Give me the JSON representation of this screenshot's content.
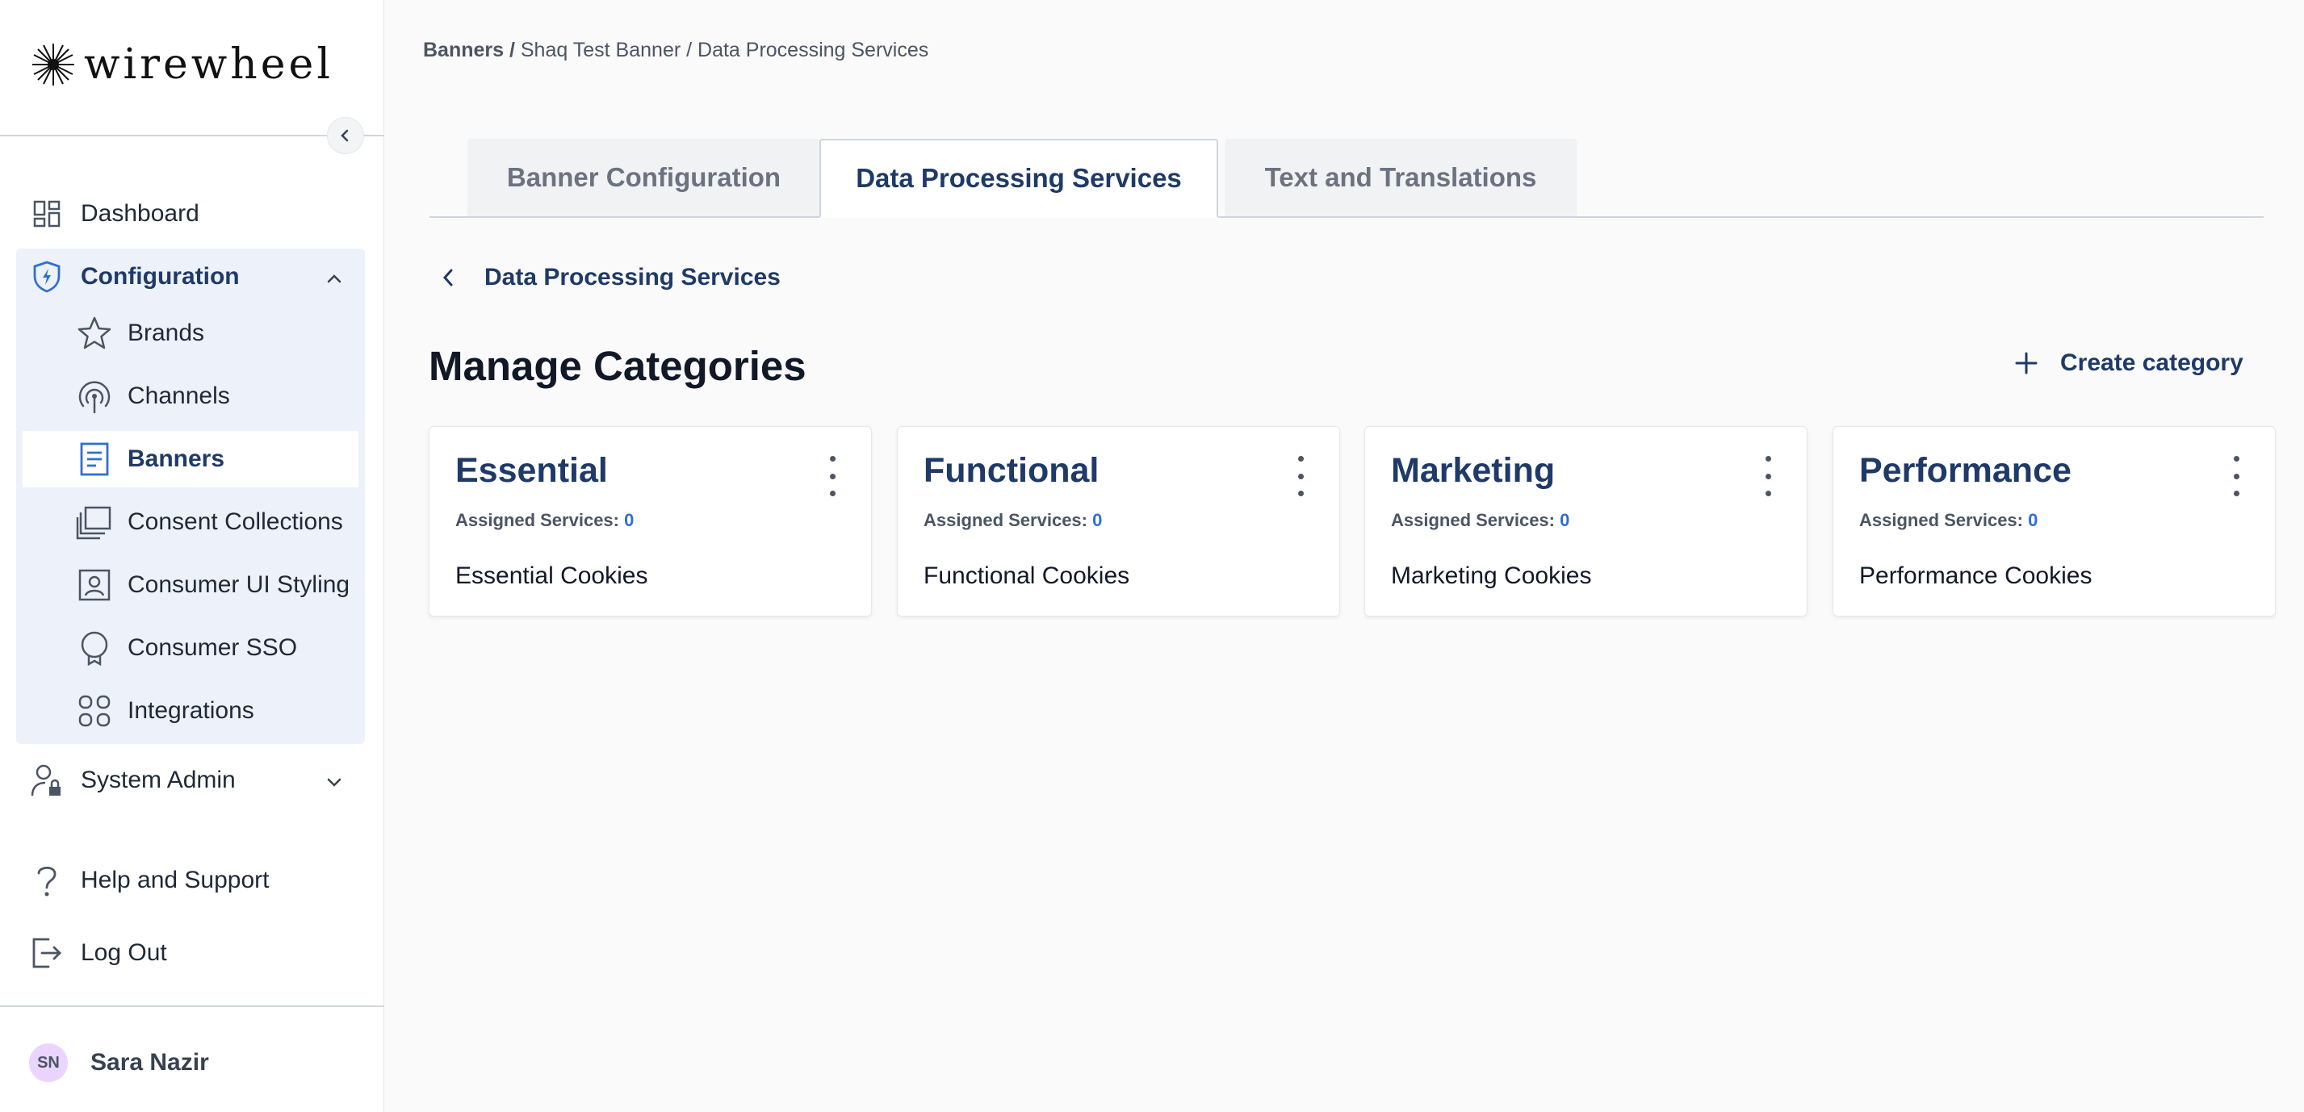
{
  "brand": {
    "name": "wirewheel"
  },
  "sidebar": {
    "dashboard": "Dashboard",
    "configuration": "Configuration",
    "config_items": [
      {
        "label": "Brands",
        "icon": "star-icon"
      },
      {
        "label": "Channels",
        "icon": "broadcast-icon"
      },
      {
        "label": "Banners",
        "icon": "document-icon",
        "active": true
      },
      {
        "label": "Consent Collections",
        "icon": "folders-icon"
      },
      {
        "label": "Consumer UI Styling",
        "icon": "user-box-icon"
      },
      {
        "label": "Consumer SSO",
        "icon": "badge-icon"
      },
      {
        "label": "Integrations",
        "icon": "grid-icon"
      }
    ],
    "system_admin": "System Admin",
    "help": "Help and Support",
    "logout": "Log Out"
  },
  "user": {
    "initials": "SN",
    "name": "Sara Nazir"
  },
  "breadcrumb": {
    "root": "Banners /",
    "rest": " Shaq Test Banner / Data Processing Services"
  },
  "tabs": [
    {
      "label": "Banner Configuration",
      "active": false
    },
    {
      "label": "Data Processing Services",
      "active": true
    },
    {
      "label": "Text and Translations",
      "active": false
    }
  ],
  "back_label": "Data Processing Services",
  "page_title": "Manage Categories",
  "create_label": "Create category",
  "assigned_label": "Assigned Services:",
  "categories": [
    {
      "title": "Essential",
      "assigned": "0",
      "description": "Essential Cookies"
    },
    {
      "title": "Functional",
      "assigned": "0",
      "description": "Functional Cookies"
    },
    {
      "title": "Marketing",
      "assigned": "0",
      "description": "Marketing Cookies"
    },
    {
      "title": "Performance",
      "assigned": "0",
      "description": "Performance Cookies"
    }
  ],
  "colors": {
    "accent": "#1f3a68",
    "link_blue": "#2f6fd1",
    "active_group_bg": "#edf1f9"
  }
}
